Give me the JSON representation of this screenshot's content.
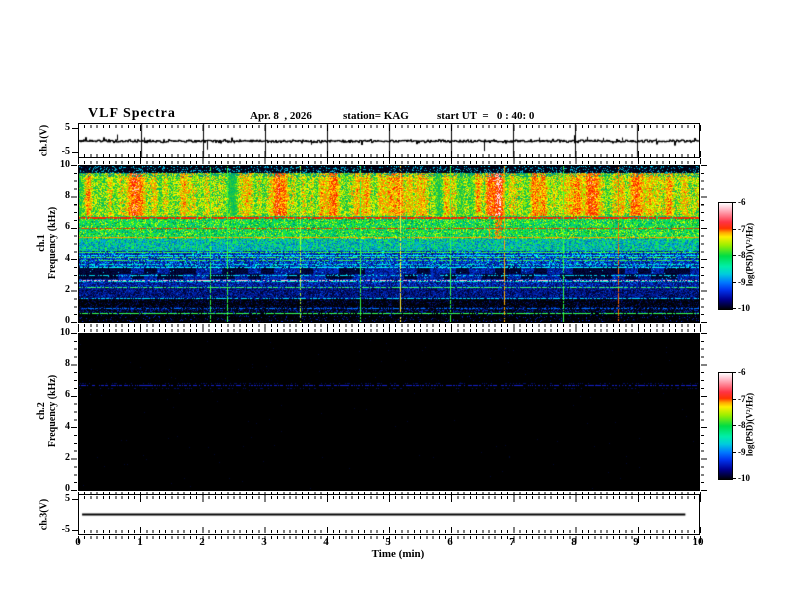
{
  "header": {
    "title": "VLF Spectra",
    "date": "Apr. 8  , 2026",
    "station": "station= KAG",
    "start_ut": "start UT  =   0 : 40: 0"
  },
  "x_axis": {
    "label": "Time (min)",
    "min": 0,
    "max": 10,
    "tick_labels": [
      "0",
      "1",
      "2",
      "3",
      "4",
      "5",
      "6",
      "7",
      "8",
      "9",
      "10"
    ],
    "minor_step_min": 0.1
  },
  "colorbar": {
    "label": "log(PSD)(V²/Hz)",
    "tick_labels": [
      "-6",
      "-7",
      "-8",
      "-9",
      "-10"
    ],
    "zlim": [
      -10,
      -6
    ],
    "gradient_stops": [
      [
        "0%",
        "#000008"
      ],
      [
        "9%",
        "#000090"
      ],
      [
        "18%",
        "#0033ee"
      ],
      [
        "25%",
        "#0077ff"
      ],
      [
        "33%",
        "#00ccdd"
      ],
      [
        "40%",
        "#00eeaa"
      ],
      [
        "50%",
        "#00dd44"
      ],
      [
        "60%",
        "#99ee00"
      ],
      [
        "68%",
        "#ffee00"
      ],
      [
        "72%",
        "#ffaa00"
      ],
      [
        "76%",
        "#ff3300"
      ],
      [
        "82%",
        "#ff3344"
      ],
      [
        "88%",
        "#ff7788"
      ],
      [
        "94%",
        "#ffbbc8"
      ],
      [
        "98%",
        "#ffe8ee"
      ],
      [
        "100%",
        "#ffffff"
      ]
    ]
  },
  "panels": {
    "ch1v": {
      "ylabel": "ch.1(V)",
      "ytick_labels": [
        "5",
        "-5"
      ],
      "ylim": [
        -5,
        5
      ]
    },
    "spec1": {
      "ylabel_ch": "ch.1",
      "ylabel_freq": "Frequency (kHz)",
      "ytick_labels": [
        "10",
        "8",
        "6",
        "4",
        "2",
        "0"
      ],
      "ylim": [
        0,
        10
      ]
    },
    "spec2": {
      "ylabel_ch": "ch.2",
      "ylabel_freq": "Frequency (kHz)",
      "ytick_labels": [
        "10",
        "8",
        "6",
        "4",
        "2",
        "0"
      ],
      "ylim": [
        0,
        10
      ]
    },
    "ch3v": {
      "ylabel": "ch.3(V)",
      "ytick_labels": [
        "5",
        "-5"
      ],
      "ylim": [
        -5,
        5
      ]
    }
  },
  "chart_data": [
    {
      "id": "ch1_voltage",
      "type": "line",
      "title": "ch.1(V) waveform",
      "xlim": [
        0,
        10
      ],
      "ylim": [
        -5,
        5
      ],
      "baseline": 0,
      "noise_amp_v": 0.3,
      "grid_vertical_every_min": 1,
      "spikes": [
        {
          "t": 0.61,
          "v": 1.8
        },
        {
          "t": 1.05,
          "v": 0.9
        },
        {
          "t": 2.06,
          "v": -2.8
        },
        {
          "t": 2.5,
          "v": -0.9
        },
        {
          "t": 3.1,
          "v": -0.8
        },
        {
          "t": 3.74,
          "v": -1.3
        },
        {
          "t": 4.4,
          "v": -0.7
        },
        {
          "t": 5.15,
          "v": -0.6
        },
        {
          "t": 6.54,
          "v": -3.2
        },
        {
          "t": 7.0,
          "v": 0.8
        },
        {
          "t": 7.42,
          "v": 0.9
        },
        {
          "t": 7.99,
          "v": 1.6
        },
        {
          "t": 8.2,
          "v": 1.1
        },
        {
          "t": 8.45,
          "v": 0.8
        },
        {
          "t": 8.75,
          "v": 0.9
        },
        {
          "t": 9.3,
          "v": 0.6
        }
      ]
    },
    {
      "id": "ch1_spectrogram",
      "type": "heatmap",
      "title": "ch.1 VLF spectrogram",
      "xlim": [
        0,
        10
      ],
      "ylim": [
        0,
        10
      ],
      "zlim": [
        -10,
        -6
      ],
      "zlabel": "log(PSD)(V²/Hz)",
      "bands": [
        {
          "f0": 9.55,
          "f1": 10.0,
          "kind": "topdark"
        },
        {
          "f0": 6.78,
          "f1": 9.55,
          "kind": "redstreak"
        },
        {
          "f0": 5.35,
          "f1": 6.78,
          "kind": "greenmix"
        },
        {
          "f0": 4.55,
          "f1": 5.35,
          "kind": "cyangreen"
        },
        {
          "f0": 3.55,
          "f1": 4.55,
          "kind": "bluemix"
        },
        {
          "f0": 2.78,
          "f1": 3.55,
          "kind": "blueblocks"
        },
        {
          "f0": 2.2,
          "f1": 2.78,
          "kind": "bluemed"
        },
        {
          "f0": 1.45,
          "f1": 2.2,
          "kind": "bluedark"
        },
        {
          "f0": 0.95,
          "f1": 1.45,
          "kind": "nearblack"
        },
        {
          "f0": 0.6,
          "f1": 0.95,
          "kind": "darknavy"
        },
        {
          "f0": 0.0,
          "f1": 0.6,
          "kind": "blackish"
        }
      ],
      "palettes": {
        "topdark": {
          "base": "#000011",
          "alt": "#001144",
          "dot": "#00bbdd"
        },
        "redstreak": {
          "white": "#ffffff",
          "pink": "#ffccc8",
          "red": "#ff2000",
          "red2": "#ee4400",
          "orange": "#ff8800",
          "yellow": "#ffee00",
          "lime": "#99ee00",
          "green": "#33cc33",
          "green2": "#00bb66",
          "teal": "#009988"
        },
        "greenmix": {
          "hot1": "#ff5500",
          "hot2": "#ffaa00",
          "c": [
            "#ccff00",
            "#33ee22",
            "#00dd66",
            "#00bb99",
            "#009944"
          ]
        },
        "cyangreen": {
          "c": [
            "#22ee44",
            "#00cc88",
            "#00aadd",
            "#0077bb"
          ]
        },
        "bluemix": {
          "c": [
            "#00ffee",
            "#0077ff",
            "#0044dd",
            "#0022aa",
            "#000f66"
          ],
          "dot": "#00ee55"
        },
        "blueblocks": {
          "dark": [
            "#000022",
            "#000a44"
          ],
          "blue": [
            "#0033cc",
            "#0022aa",
            "#000f66"
          ],
          "dot": "#00ccff"
        },
        "bluemed": {
          "c": [
            "#0066ff",
            "#0033cc",
            "#001a99",
            "#000a55"
          ]
        },
        "bluedark": {
          "c": [
            "#0044dd",
            "#0022aa",
            "#001177",
            "#000533"
          ]
        },
        "nearblack": {
          "c": [
            "#001177",
            "#000533",
            "#000205"
          ]
        },
        "darknavy": {
          "c": [
            "#0022aa",
            "#000a44",
            "#000208"
          ]
        },
        "blackish": {
          "c": [
            "#0022bb",
            "#000633",
            "#000103"
          ]
        }
      },
      "h_lines": [
        {
          "f": 6.7,
          "color": "#ff2200",
          "density": 0.95,
          "w": 2
        },
        {
          "f": 6.0,
          "color": "#ee3300",
          "density": 0.7,
          "w": 1
        },
        {
          "f": 5.42,
          "color": "#ff9900",
          "density": 0.85,
          "w": 1
        },
        {
          "f": 4.5,
          "color": "#33ff33",
          "density": 0.9,
          "w": 1
        },
        {
          "f": 4.3,
          "color": "#00ffee",
          "density": 0.8,
          "w": 1
        },
        {
          "f": 4.15,
          "color": "#44ff44",
          "density": 0.7,
          "w": 1
        },
        {
          "f": 3.95,
          "color": "#33ee55",
          "density": 0.7,
          "w": 1
        },
        {
          "f": 3.75,
          "color": "#00eebb",
          "density": 0.6,
          "w": 1
        },
        {
          "f": 3.5,
          "color": "#00ffee",
          "density": 0.8,
          "w": 1
        },
        {
          "f": 3.0,
          "color": "#00ddee",
          "density": 0.6,
          "w": 1
        },
        {
          "f": 2.68,
          "color": "#ffbbdd",
          "density": 0.55,
          "w": 1
        },
        {
          "f": 2.6,
          "color": "#00ffcc",
          "density": 0.6,
          "w": 1
        },
        {
          "f": 2.25,
          "color": "#33ff66",
          "density": 0.75,
          "w": 1
        },
        {
          "f": 1.52,
          "color": "#00ddff",
          "density": 0.6,
          "w": 1
        },
        {
          "f": 0.92,
          "color": "#0077ff",
          "density": 0.5,
          "w": 1
        },
        {
          "f": 0.55,
          "color": "#33ff55",
          "density": 0.8,
          "w": 1
        }
      ],
      "v_lines": [
        {
          "t": 2.12,
          "color": "#33ff44"
        },
        {
          "t": 2.38,
          "color": "#33ff44"
        },
        {
          "t": 3.57,
          "color": "#aaff33"
        },
        {
          "t": 4.53,
          "color": "#33ff44"
        },
        {
          "t": 5.18,
          "color": "#ffee33"
        },
        {
          "t": 5.98,
          "color": "#33ff44"
        },
        {
          "t": 6.86,
          "color": "#ffaa00"
        },
        {
          "t": 7.8,
          "color": "#33ff44"
        },
        {
          "t": 8.7,
          "color": "#ff6600"
        }
      ]
    },
    {
      "id": "ch2_spectrogram",
      "type": "heatmap",
      "title": "ch.2 VLF spectrogram (no signal)",
      "xlim": [
        0,
        10
      ],
      "ylim": [
        0,
        10
      ],
      "zlim": [
        -10,
        -6
      ],
      "zlabel": "log(PSD)(V²/Hz)",
      "background": "#000000",
      "h_lines": [
        {
          "f": 6.7,
          "color": "#1520cc",
          "density": 0.55,
          "w": 1
        },
        {
          "f": 6.85,
          "color": "#000d66",
          "density": 0.25,
          "w": 1
        },
        {
          "f": 6.55,
          "color": "#000d66",
          "density": 0.18,
          "w": 1
        }
      ],
      "noise": {
        "density": 0.0015,
        "color": "#000a33"
      }
    },
    {
      "id": "ch3_voltage",
      "type": "line",
      "title": "ch.3(V) waveform",
      "xlim": [
        0,
        10
      ],
      "ylim": [
        -5,
        5
      ],
      "baseline": 0,
      "flat": true,
      "span": [
        0.05,
        9.78
      ],
      "line_width": 2
    }
  ]
}
